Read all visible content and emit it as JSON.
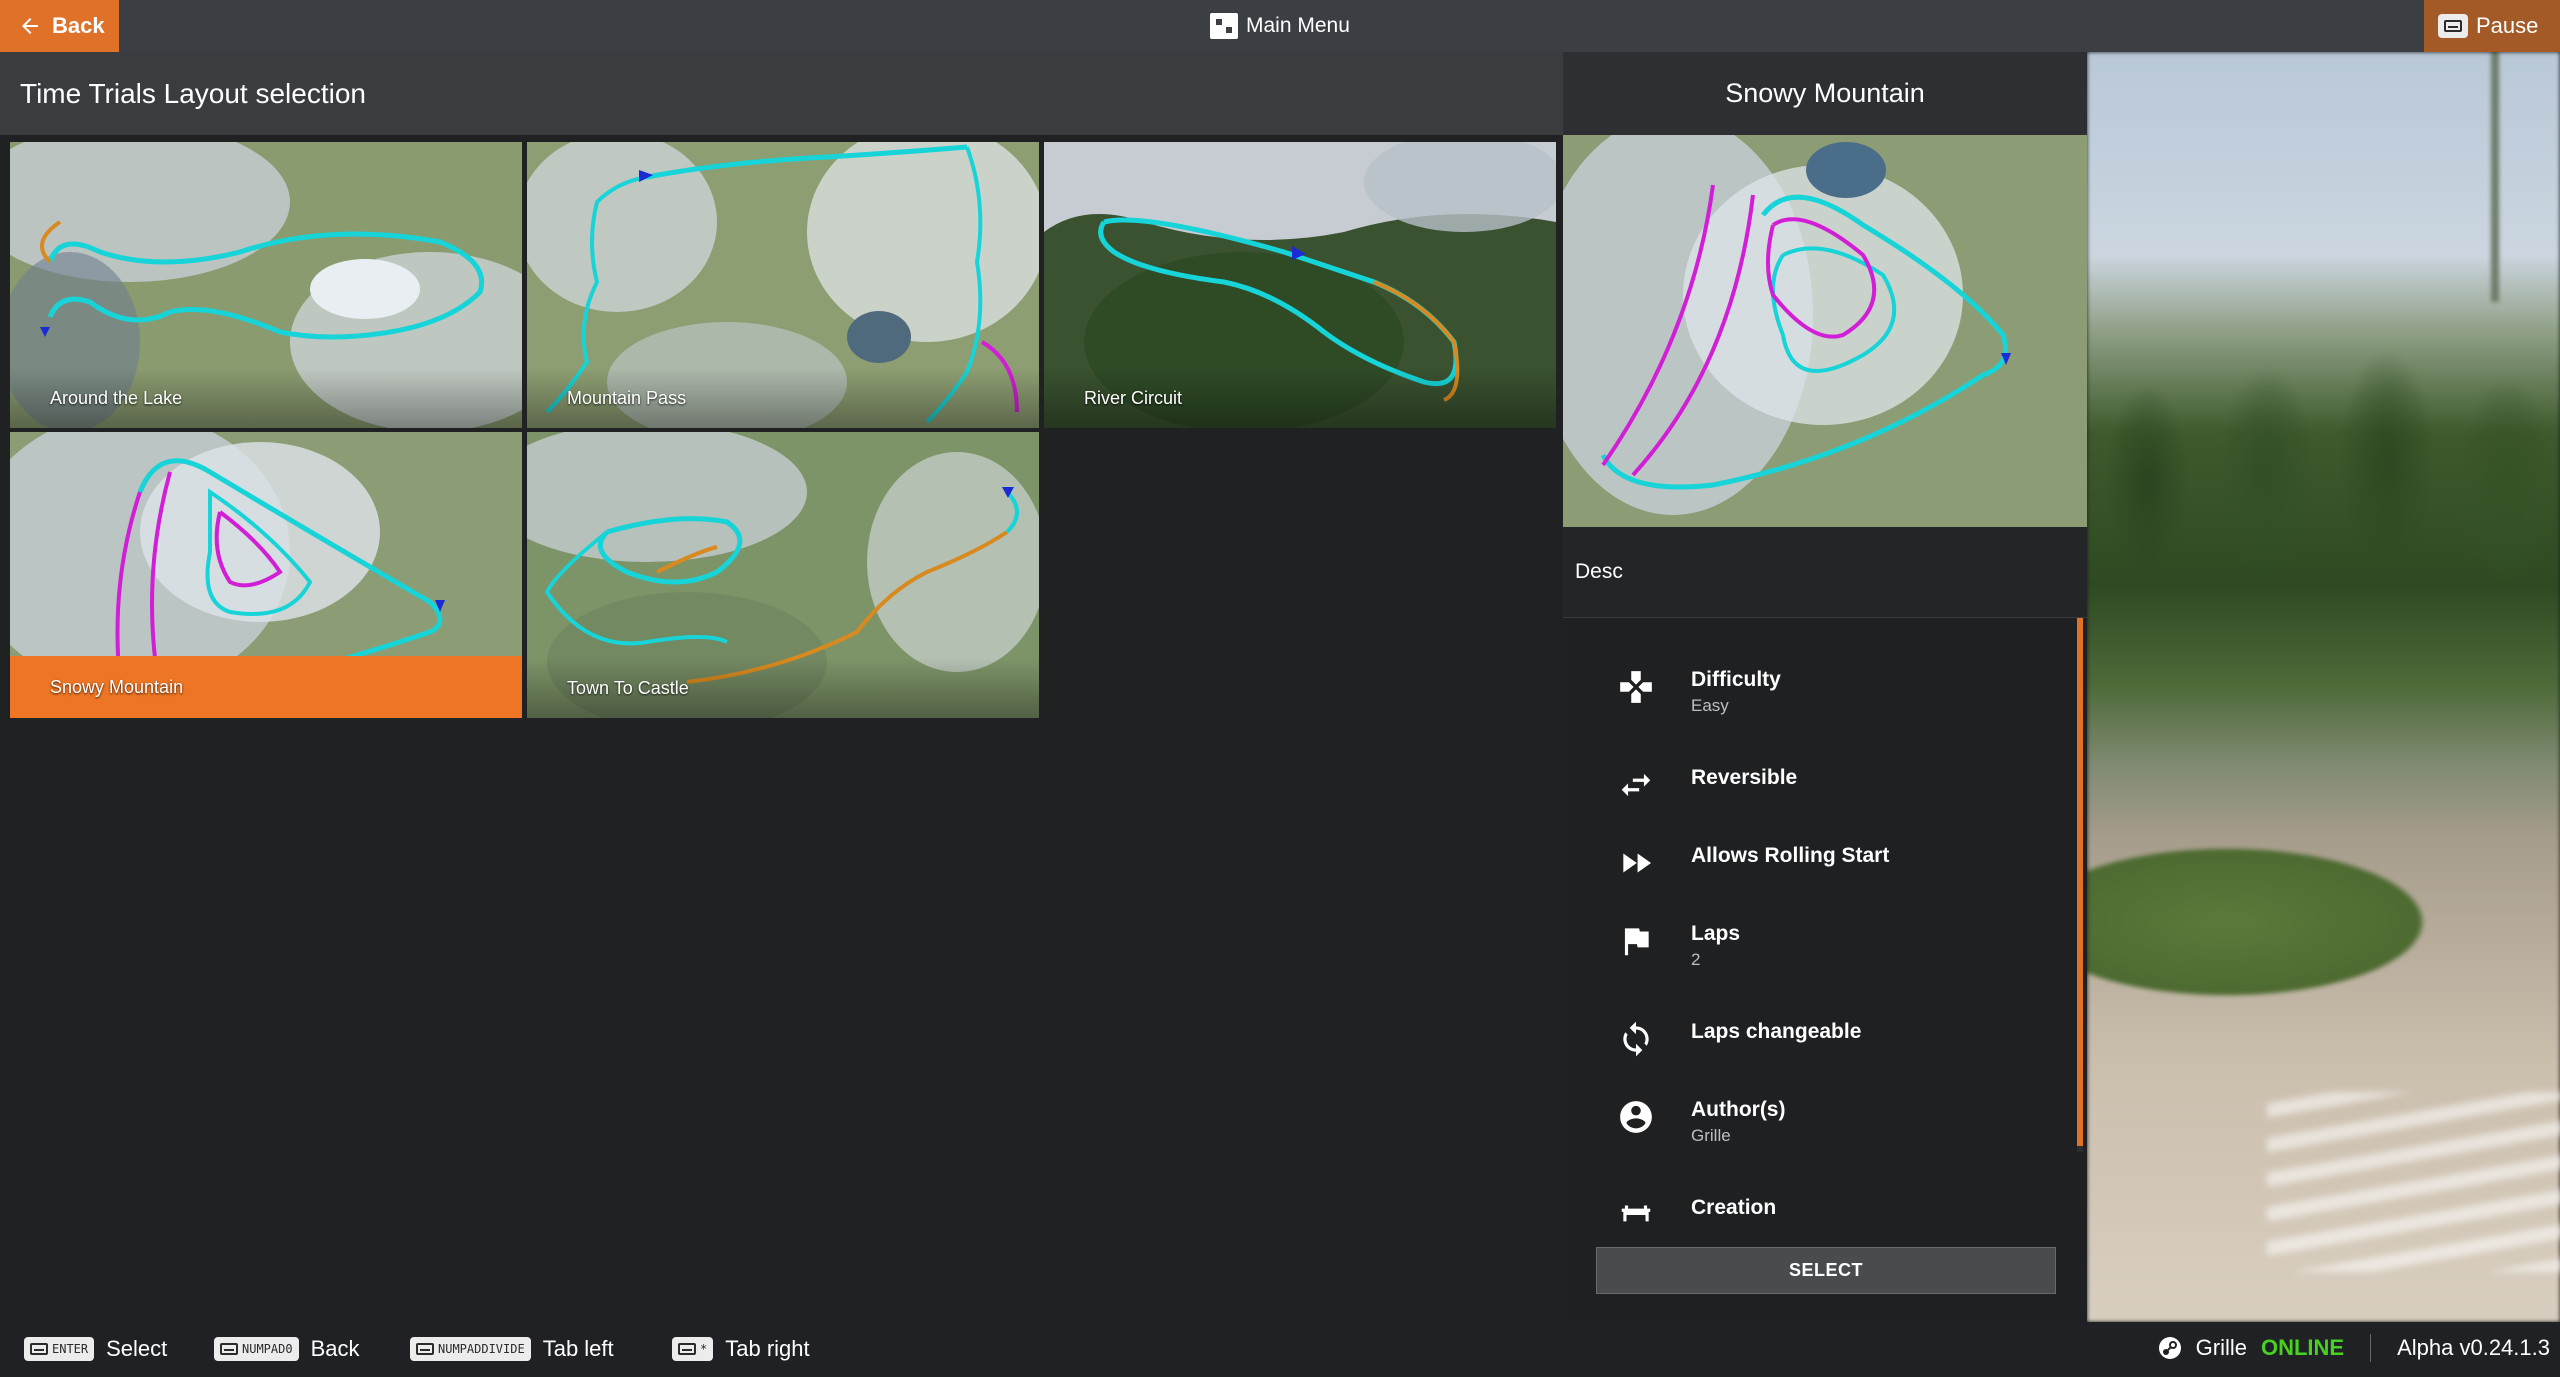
{
  "topbar": {
    "back_label": "Back",
    "main_menu_label": "Main Menu",
    "pause_label": "Pause"
  },
  "left_panel": {
    "title": "Time Trials Layout selection",
    "tracks": [
      {
        "name": "Around the Lake",
        "selected": false
      },
      {
        "name": "Mountain Pass",
        "selected": false
      },
      {
        "name": "River Circuit",
        "selected": false
      },
      {
        "name": "Snowy Mountain",
        "selected": true
      },
      {
        "name": "Town To Castle",
        "selected": false
      }
    ]
  },
  "detail": {
    "title": "Snowy Mountain",
    "desc": "Desc",
    "properties": [
      {
        "icon": "gamepad-icon",
        "name": "Difficulty",
        "value": "Easy"
      },
      {
        "icon": "swap-arrows-icon",
        "name": "Reversible",
        "value": ""
      },
      {
        "icon": "fast-forward-icon",
        "name": "Allows Rolling Start",
        "value": ""
      },
      {
        "icon": "flag-icon",
        "name": "Laps",
        "value": "2"
      },
      {
        "icon": "sync-icon",
        "name": "Laps changeable",
        "value": ""
      },
      {
        "icon": "account-circle-icon",
        "name": "Author(s)",
        "value": "Grille"
      },
      {
        "icon": "creation-icon",
        "name": "Creation",
        "value": ""
      }
    ],
    "select_label": "SELECT"
  },
  "bottombar": {
    "hints": [
      {
        "key": "ENTER",
        "label": "Select"
      },
      {
        "key": "NUMPAD0",
        "label": "Back"
      },
      {
        "key": "NUMPADDIVIDE",
        "label": "Tab left"
      },
      {
        "key": "*",
        "label": "Tab right"
      }
    ],
    "username": "Grille",
    "online_status": "ONLINE",
    "version": "Alpha v0.24.1.3"
  },
  "colors": {
    "accent": "#ed7524",
    "online": "#46d21e",
    "track_cyan": "#16d4d8",
    "track_magenta": "#d21ed6",
    "track_orange": "#d98a1e"
  }
}
